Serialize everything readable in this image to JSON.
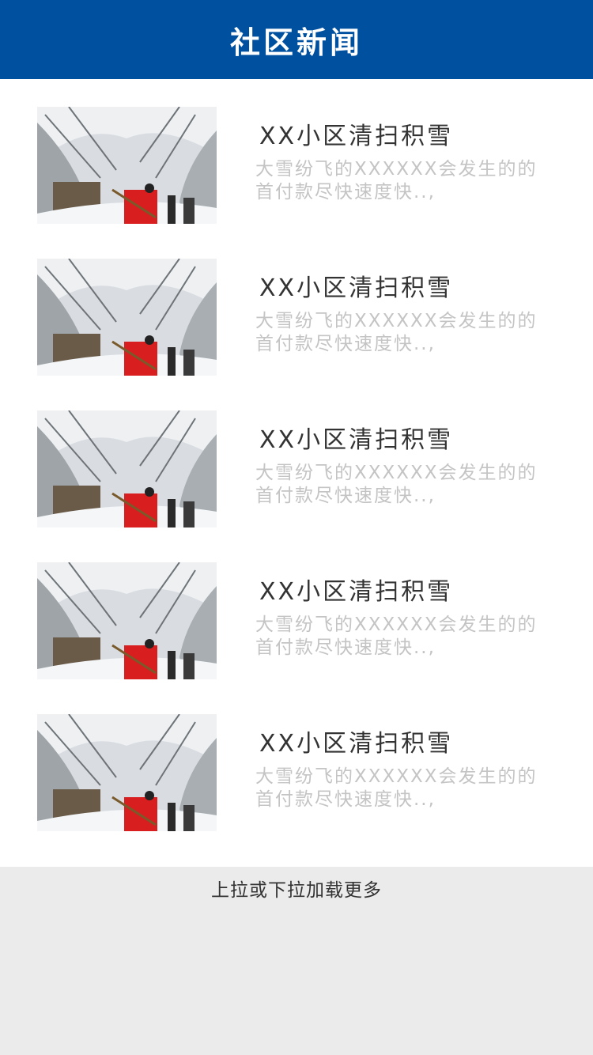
{
  "header": {
    "title": "社区新闻"
  },
  "news": [
    {
      "title": "XX小区清扫积雪",
      "summary": "大雪纷飞的XXXXXX会发生的的首付款尽快速度快..,",
      "image": "snow-street-sweeping-photo"
    },
    {
      "title": "XX小区清扫积雪",
      "summary": "大雪纷飞的XXXXXX会发生的的首付款尽快速度快..,",
      "image": "snow-street-sweeping-photo"
    },
    {
      "title": "XX小区清扫积雪",
      "summary": "大雪纷飞的XXXXXX会发生的的首付款尽快速度快..,",
      "image": "snow-street-sweeping-photo"
    },
    {
      "title": "XX小区清扫积雪",
      "summary": "大雪纷飞的XXXXXX会发生的的首付款尽快速度快..,",
      "image": "snow-street-sweeping-photo"
    },
    {
      "title": "XX小区清扫积雪",
      "summary": "大雪纷飞的XXXXXX会发生的的首付款尽快速度快..,",
      "image": "snow-street-sweeping-photo"
    }
  ],
  "footer": {
    "load_more": "上拉或下拉加载更多"
  },
  "colors": {
    "header_bg": "#0050a0",
    "title": "#333333",
    "summary": "#c4c4c4",
    "footer_bg": "#ebebeb"
  }
}
